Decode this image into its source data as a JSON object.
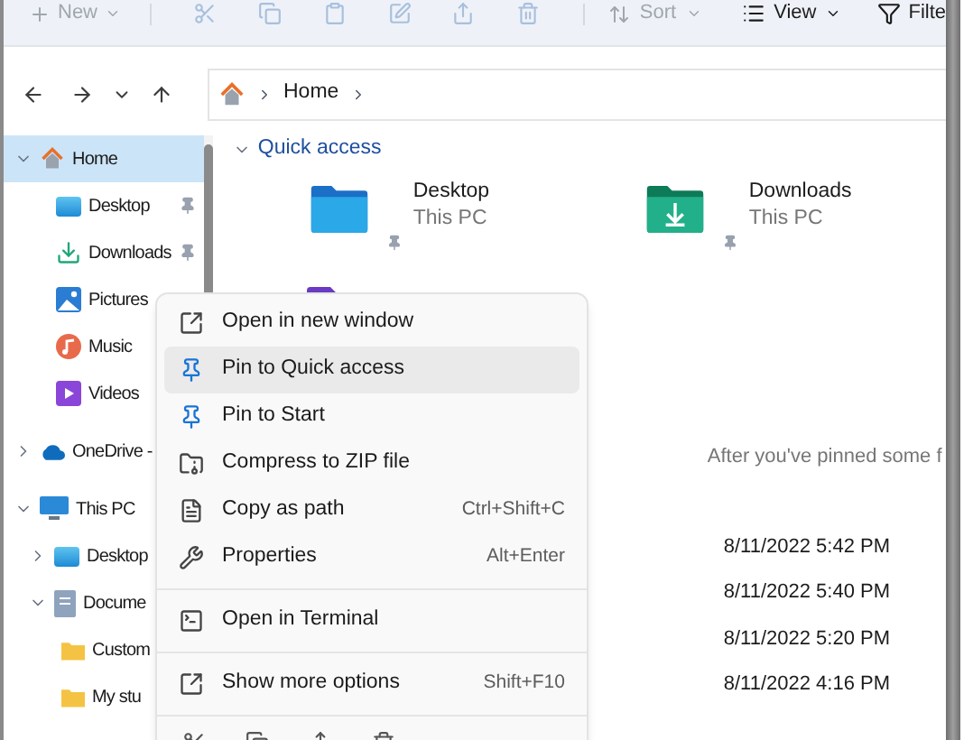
{
  "toolbar": {
    "new": {
      "label": "New",
      "disabled": true
    },
    "sort": {
      "label": "Sort",
      "disabled": true
    },
    "view": {
      "label": "View",
      "disabled": false
    },
    "filter": {
      "label": "Filte",
      "disabled": false
    }
  },
  "address": {
    "segments": [
      "Home"
    ]
  },
  "sidebar": {
    "items": [
      {
        "kind": "home",
        "label": "Home",
        "selected": true,
        "expanded": true,
        "children": [
          {
            "kind": "desktop",
            "label": "Desktop",
            "selected": false,
            "pinned": true
          },
          {
            "kind": "downloads",
            "label": "Downloads",
            "selected": false,
            "pinned": true
          },
          {
            "kind": "pictures",
            "label": "Pictures",
            "selected": false
          },
          {
            "kind": "music",
            "label": "Music",
            "selected": false
          },
          {
            "kind": "videos",
            "label": "Videos",
            "selected": false
          }
        ]
      },
      {
        "kind": "cloud",
        "label": "OneDrive -",
        "selected": false,
        "expanded": false
      },
      {
        "kind": "pc",
        "label": "This PC",
        "selected": false,
        "expanded": true,
        "children": [
          {
            "kind": "desktop",
            "label": "Desktop",
            "selected": false,
            "expanded": false
          },
          {
            "kind": "documents",
            "label": "Docume",
            "selected": false,
            "expanded": true,
            "children": [
              {
                "kind": "folder",
                "label": "Custom",
                "selected": false
              },
              {
                "kind": "folder",
                "label": "My stu",
                "selected": false
              }
            ]
          }
        ]
      }
    ]
  },
  "quick_access": {
    "title": "Quick access",
    "expanded": true,
    "tiles": [
      {
        "kind": "desktop",
        "name": "Desktop",
        "location": "This PC",
        "pinned": true
      },
      {
        "kind": "downloads",
        "name": "Downloads",
        "location": "This PC",
        "pinned": true
      },
      {
        "kind": "videos"
      }
    ]
  },
  "empty_message": "After you've pinned some f",
  "recent_dates": [
    "8/11/2022 5:42 PM",
    "8/11/2022 5:40 PM",
    "8/11/2022 5:20 PM",
    "8/11/2022 4:16 PM"
  ],
  "context_menu": {
    "items": [
      {
        "kind": "item",
        "label": "Open in new window",
        "selected": false
      },
      {
        "kind": "item",
        "label": "Pin to Quick access",
        "selected": true
      },
      {
        "kind": "item",
        "label": "Pin to Start",
        "selected": false
      },
      {
        "kind": "item",
        "label": "Compress to ZIP file",
        "selected": false
      },
      {
        "kind": "item",
        "label": "Copy as path",
        "shortcut": "Ctrl+Shift+C",
        "selected": false
      },
      {
        "kind": "item",
        "label": "Properties",
        "shortcut": "Alt+Enter",
        "selected": false
      },
      {
        "kind": "separator"
      },
      {
        "kind": "item",
        "label": "Open in Terminal",
        "selected": false
      },
      {
        "kind": "separator"
      },
      {
        "kind": "item",
        "label": "Show more options",
        "shortcut": "Shift+F10",
        "selected": false
      },
      {
        "kind": "separator"
      }
    ]
  }
}
